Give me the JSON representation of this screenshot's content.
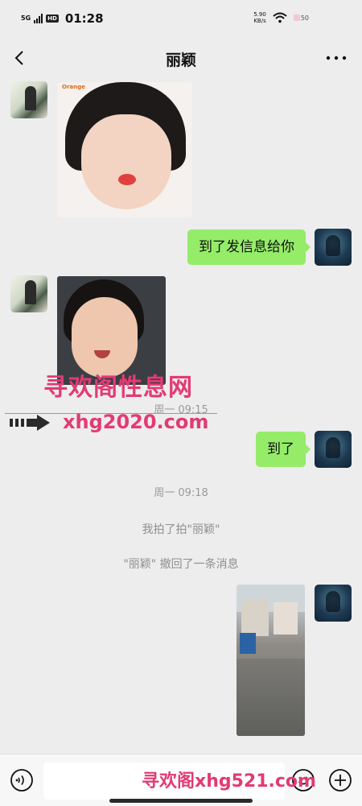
{
  "status_bar": {
    "network": "5G",
    "hd": "HD",
    "time": "01:28",
    "speed_value": "5.90",
    "speed_unit": "KB/s",
    "battery": "50"
  },
  "nav": {
    "title": "丽颖",
    "back_icon": "chevron-left-icon",
    "more_icon": "more-dots-icon"
  },
  "messages": {
    "b1": "到了发信息给你",
    "b2": "到了",
    "time_1": "周一 09:15",
    "time_2": "周一 09:18",
    "pat": "我拍了拍\"丽颖\"",
    "recall": "\"丽颖\" 撤回了一条消息",
    "photo_1_tag": "Orange"
  },
  "watermarks": {
    "site_cn": "寻欢阁性息网",
    "site_url": "xhg2020.com",
    "bottom": "寻欢阁xhg521.com"
  },
  "input_bar": {
    "placeholder": "",
    "voice_icon": "voice-icon",
    "emoji_icon": "emoji-icon",
    "plus_icon": "plus-circle-icon"
  },
  "colors": {
    "background": "#ededed",
    "bubble_mine": "#95ec69",
    "watermark": "#e33a73"
  }
}
